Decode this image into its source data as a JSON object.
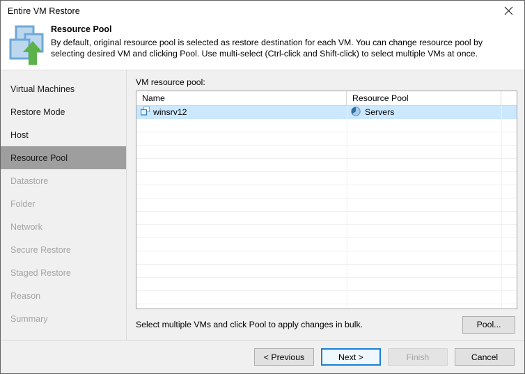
{
  "window": {
    "title": "Entire VM Restore",
    "close_icon": "close-icon"
  },
  "header": {
    "icon": "vm-restore-icon",
    "title": "Resource Pool",
    "description": "By default, original resource pool is selected as restore destination for each VM. You can change resource pool by selecting desired VM and clicking Pool. Use multi-select (Ctrl-click and Shift-click) to select multiple VMs at once."
  },
  "sidebar": {
    "items": [
      {
        "label": "Virtual Machines",
        "state": "done"
      },
      {
        "label": "Restore Mode",
        "state": "done"
      },
      {
        "label": "Host",
        "state": "done"
      },
      {
        "label": "Resource Pool",
        "state": "active"
      },
      {
        "label": "Datastore",
        "state": "pending"
      },
      {
        "label": "Folder",
        "state": "pending"
      },
      {
        "label": "Network",
        "state": "pending"
      },
      {
        "label": "Secure Restore",
        "state": "pending"
      },
      {
        "label": "Staged Restore",
        "state": "pending"
      },
      {
        "label": "Reason",
        "state": "pending"
      },
      {
        "label": "Summary",
        "state": "pending"
      }
    ]
  },
  "main": {
    "list_label": "VM resource pool:",
    "table": {
      "columns": [
        "Name",
        "Resource Pool",
        ""
      ],
      "rows": [
        {
          "name": "winsrv12",
          "name_icon": "virtual-machine-icon",
          "pool": "Servers",
          "pool_icon": "resource-pool-icon",
          "selected": true
        }
      ],
      "blank_row_count": 14
    },
    "hint": "Select multiple VMs and click Pool to apply changes in bulk.",
    "pool_button": "Pool..."
  },
  "footer": {
    "previous": "< Previous",
    "next": "Next >",
    "finish": "Finish",
    "cancel": "Cancel",
    "finish_disabled": true,
    "next_is_default": true
  },
  "colors": {
    "selection_blue": "#cce8ff",
    "accent_blue": "#1a7fd4",
    "icon_blue": "#6ea9d7",
    "icon_green": "#5bb14a",
    "sidebar_bg": "#f0f0f0",
    "active_nav_bg": "#9e9e9e"
  }
}
